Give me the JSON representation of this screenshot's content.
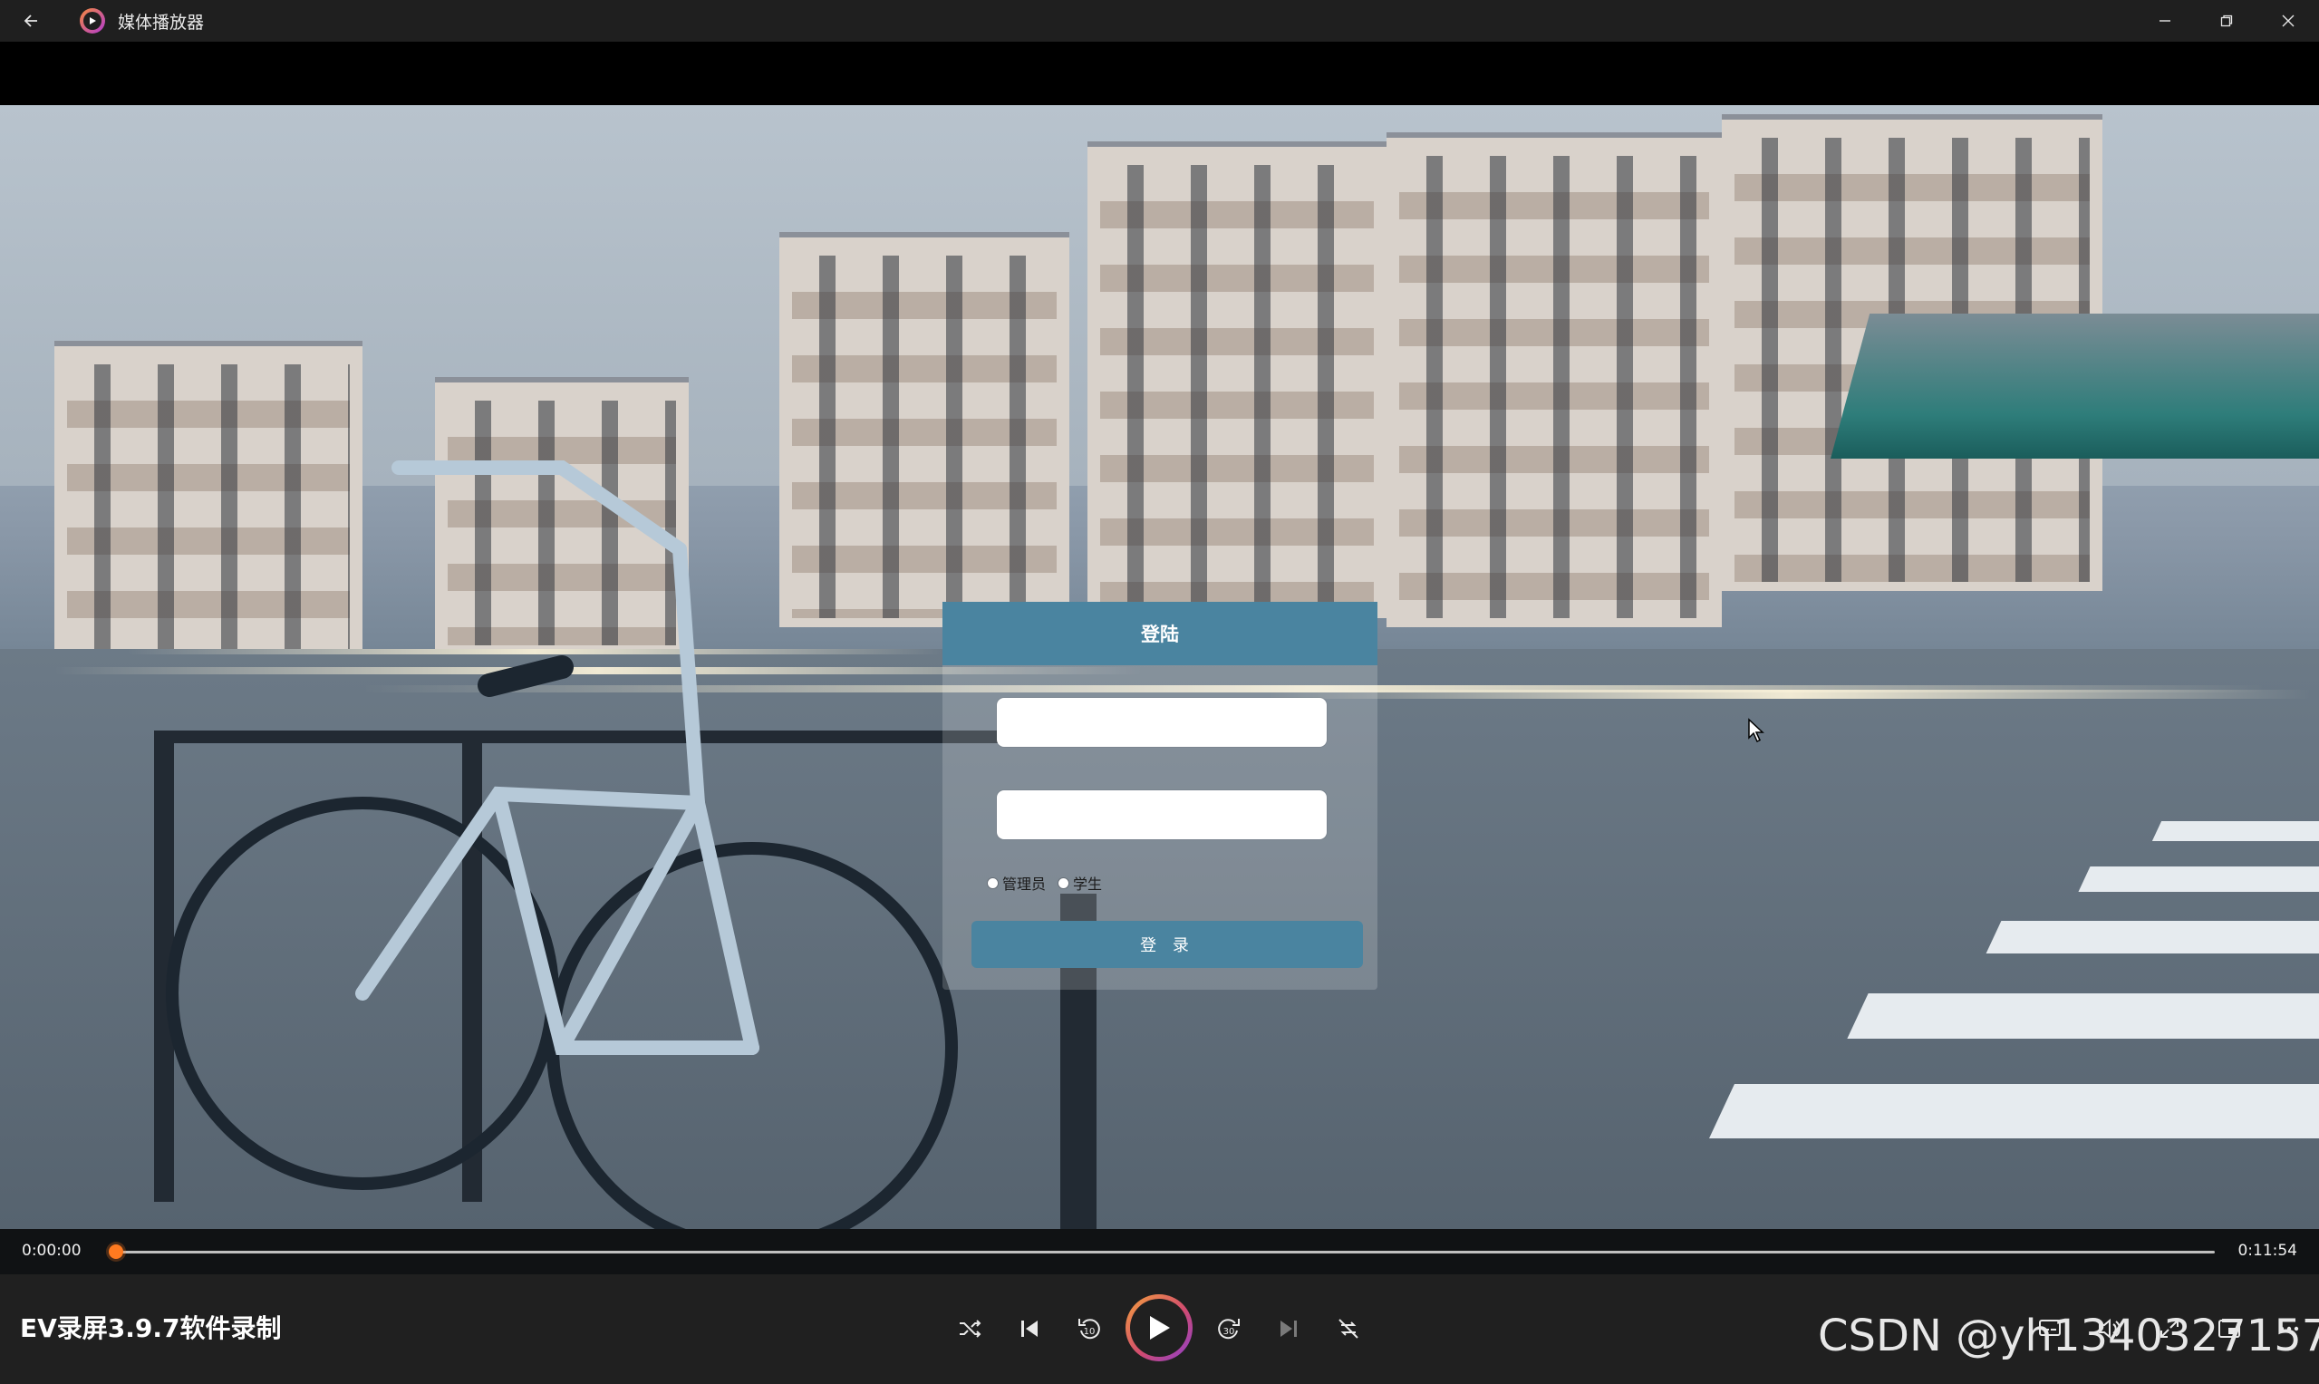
{
  "window": {
    "title": "媒体播放器"
  },
  "login": {
    "header": "登陆",
    "username_placeholder": "",
    "password_placeholder": "",
    "role_options": [
      "管理员",
      "学生"
    ],
    "submit_label": "登 录"
  },
  "player": {
    "media_title": "EV录屏3.9.7软件录制",
    "current_time": "0:00:00",
    "total_time": "0:11:54",
    "progress_fraction": 0.0
  },
  "watermark": "CSDN @yh1340327157",
  "colors": {
    "accent": "#ff7a20",
    "login_primary": "#4a84a0",
    "titlebar_bg": "#1f1f1f",
    "controls_bg": "#202020"
  }
}
